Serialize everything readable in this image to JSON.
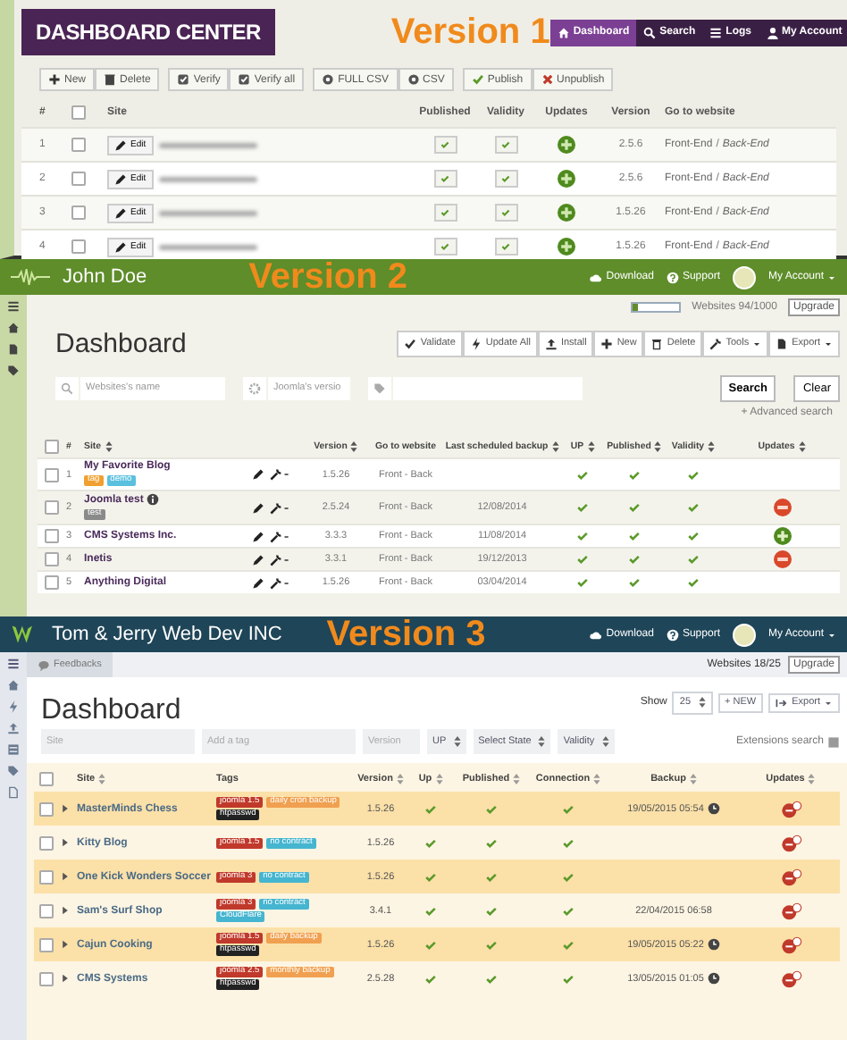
{
  "v1": {
    "brand": "DASHBOARD CENTER",
    "version_label": "Version 1",
    "nav": [
      {
        "label": "Dashboard",
        "selected": true
      },
      {
        "label": "Search",
        "selected": false
      },
      {
        "label": "Logs",
        "selected": false
      },
      {
        "label": "My Account",
        "selected": false
      }
    ],
    "toolbar": [
      [
        {
          "label": "New",
          "kind": "plus"
        },
        {
          "label": "Delete",
          "kind": "trash"
        }
      ],
      [
        {
          "label": "Verify",
          "kind": "check"
        },
        {
          "label": "Verify all",
          "kind": "check"
        }
      ],
      [
        {
          "label": "FULL CSV",
          "kind": "disc"
        },
        {
          "label": "CSV",
          "kind": "disc"
        }
      ],
      [
        {
          "label": "Publish",
          "kind": "tick"
        },
        {
          "label": "Unpublish",
          "kind": "cross"
        }
      ]
    ],
    "select_all_checked": false,
    "columns": [
      "#",
      "Site",
      "Published",
      "Validity",
      "Updates",
      "Version",
      "Go to website"
    ],
    "rows": [
      {
        "num": "1",
        "checked": false,
        "edit": "Edit",
        "published": true,
        "validity": true,
        "updates": {
          "kind": "ok"
        },
        "version": "2.5.6",
        "front": "Front-End",
        "separator": "/",
        "back": "Back-End"
      },
      {
        "num": "2",
        "checked": false,
        "edit": "Edit",
        "published": true,
        "validity": true,
        "updates": {
          "kind": "ok"
        },
        "version": "2.5.6",
        "front": "Front-End",
        "separator": "/",
        "back": "Back-End"
      },
      {
        "num": "3",
        "checked": false,
        "edit": "Edit",
        "published": true,
        "validity": true,
        "updates": {
          "kind": "ok"
        },
        "version": "1.5.26",
        "front": "Front-End",
        "separator": "/",
        "back": "Back-End"
      },
      {
        "num": "4",
        "checked": false,
        "edit": "Edit",
        "published": true,
        "validity": true,
        "updates": {
          "kind": "ok"
        },
        "version": "1.5.26",
        "front": "Front-End",
        "separator": "/",
        "back": "Back-End"
      }
    ]
  },
  "v2": {
    "user": "John Doe",
    "version_label": "Version 2",
    "download": "Download",
    "support": "Support",
    "account": "My Account",
    "quota": {
      "level": 0.094,
      "label": "Websites 94/1000",
      "upgrade": "Upgrade"
    },
    "title": "Dashboard",
    "actions": [
      {
        "label": "Validate",
        "kind": "tick",
        "dropdown": false
      },
      {
        "label": "Update All",
        "kind": "bolt",
        "dropdown": false
      },
      {
        "label": "Install",
        "kind": "upload",
        "dropdown": false
      },
      {
        "label": "New",
        "kind": "plus",
        "dropdown": false
      },
      {
        "label": "Delete",
        "kind": "trash",
        "dropdown": false
      },
      {
        "label": "Tools",
        "kind": "wrench",
        "dropdown": true
      },
      {
        "label": "Export",
        "kind": "file",
        "dropdown": true
      }
    ],
    "filters": [
      {
        "kind": "search",
        "placeholder": "Websites's name"
      },
      {
        "kind": "gear",
        "placeholder": "Joomla's versio"
      },
      {
        "kind": "tag"
      }
    ],
    "search": "Search",
    "clear": "Clear",
    "advanced": "+ Advanced search",
    "select_all_checked": false,
    "columns": [
      {
        "label": "#",
        "sortable": false
      },
      {
        "label": "Site",
        "sortable": true
      },
      {
        "label": "Version",
        "sortable": true
      },
      {
        "label": "Go to website",
        "sortable": false
      },
      {
        "label": "Last scheduled backup",
        "sortable": true
      },
      {
        "label": "UP",
        "sortable": true
      },
      {
        "label": "Published",
        "sortable": true
      },
      {
        "label": "Validity",
        "sortable": true
      },
      {
        "label": "Updates",
        "sortable": true
      }
    ],
    "rows": [
      {
        "num": "1",
        "checked": false,
        "name": "My Favorite Blog",
        "info": false,
        "tags": [
          {
            "label": "tag",
            "color": "#f0a030"
          },
          {
            "label": "demo",
            "color": "#5bc0de"
          }
        ],
        "version": "1.5.26",
        "website": "Front - Back",
        "up": true,
        "published": true,
        "validity": true
      },
      {
        "num": "2",
        "checked": false,
        "name": "Joomla test",
        "info": true,
        "tags": [
          {
            "label": "test",
            "color": "#8a8a8a"
          }
        ],
        "version": "2.5.24",
        "website": "Front - Back",
        "backup": "12/08/2014",
        "up": true,
        "published": true,
        "validity": true,
        "updates": {
          "kind": "warn"
        }
      },
      {
        "num": "3",
        "checked": false,
        "name": "CMS Systems Inc.",
        "info": false,
        "tags": [],
        "version": "3.3.3",
        "website": "Front - Back",
        "backup": "11/08/2014",
        "up": true,
        "published": true,
        "validity": true,
        "updates": {
          "kind": "ok"
        }
      },
      {
        "num": "4",
        "checked": false,
        "name": "Inetis",
        "info": false,
        "tags": [],
        "version": "3.3.1",
        "website": "Front - Back",
        "backup": "19/12/2013",
        "up": true,
        "published": true,
        "validity": true,
        "updates": {
          "kind": "warn"
        }
      },
      {
        "num": "5",
        "checked": false,
        "name": "Anything Digital",
        "info": false,
        "tags": [],
        "version": "1.5.26",
        "website": "Front - Back",
        "backup": "03/04/2014",
        "up": true,
        "published": true,
        "validity": true
      }
    ]
  },
  "v3": {
    "company": "Tom & Jerry Web Dev INC",
    "version_label": "Version 3",
    "download": "Download",
    "support": "Support",
    "account": "My Account",
    "feedbacks": "Feedbacks",
    "quota": "Websites 18/25",
    "upgrade": "Upgrade",
    "title": "Dashboard",
    "show": "Show",
    "show_value": "25",
    "new": "+ NEW",
    "export": "Export",
    "filters": [
      {
        "kind": "input",
        "placeholder": "Site"
      },
      {
        "kind": "input",
        "placeholder": "Add a tag"
      },
      {
        "kind": "input",
        "placeholder": "Version"
      },
      {
        "kind": "select",
        "value": "UP"
      },
      {
        "kind": "select",
        "value": "Select State"
      },
      {
        "kind": "select",
        "value": "Validity"
      }
    ],
    "extensions": "Extensions search",
    "select_all_checked": false,
    "columns": [
      {
        "label": "Site",
        "sortable": true
      },
      {
        "label": "Tags",
        "sortable": false
      },
      {
        "label": "Version",
        "sortable": true
      },
      {
        "label": "Up",
        "sortable": true
      },
      {
        "label": "Published",
        "sortable": true
      },
      {
        "label": "Connection",
        "sortable": true
      },
      {
        "label": "Backup",
        "sortable": true
      },
      {
        "label": "Updates",
        "sortable": true
      }
    ],
    "rows": [
      {
        "checked": false,
        "name": "MasterMinds Chess",
        "tags": [
          {
            "label": "joomla 1.5",
            "color": "#c0392b"
          },
          {
            "label": "daily cron backup",
            "color": "#f0a050"
          },
          {
            "label": "htpasswd",
            "color": "#222222"
          }
        ],
        "version": "1.5.26",
        "up": true,
        "published": true,
        "connection": true,
        "backup": "19/05/2015 05:54",
        "backup_clock": true
      },
      {
        "checked": false,
        "name": "Kitty Blog",
        "tags": [
          {
            "label": "joomla 1.5",
            "color": "#c0392b"
          },
          {
            "label": "no contract",
            "color": "#45b5d0"
          }
        ],
        "version": "1.5.26",
        "up": true,
        "published": true,
        "connection": true,
        "backup_clock": false
      },
      {
        "checked": false,
        "name": "One Kick Wonders Soccer",
        "tags": [
          {
            "label": "joomla 3",
            "color": "#c0392b"
          },
          {
            "label": "no contract",
            "color": "#45b5d0"
          }
        ],
        "version": "1.5.26",
        "up": true,
        "published": true,
        "connection": true,
        "backup_clock": false
      },
      {
        "checked": false,
        "name": "Sam's Surf Shop",
        "tags": [
          {
            "label": "joomla 3",
            "color": "#c0392b"
          },
          {
            "label": "no contract",
            "color": "#45b5d0"
          },
          {
            "label": "CloudFlare",
            "color": "#45b5d0"
          }
        ],
        "version": "3.4.1",
        "up": true,
        "published": true,
        "connection": true,
        "backup": "22/04/2015 06:58",
        "backup_clock": false
      },
      {
        "checked": false,
        "name": "Cajun Cooking",
        "tags": [
          {
            "label": "joomla 1.5",
            "color": "#c0392b"
          },
          {
            "label": "daily backup",
            "color": "#f0a050"
          },
          {
            "label": "htpasswd",
            "color": "#222222"
          }
        ],
        "version": "1.5.26",
        "up": true,
        "published": true,
        "connection": true,
        "backup": "19/05/2015 05:22",
        "backup_clock": true
      },
      {
        "checked": false,
        "name": "CMS Systems",
        "tags": [
          {
            "label": "joomla 2.5",
            "color": "#c0392b"
          },
          {
            "label": "monthly backup",
            "color": "#f0a050"
          },
          {
            "label": "htpasswd",
            "color": "#222222"
          }
        ],
        "version": "2.5.28",
        "up": true,
        "published": true,
        "connection": true,
        "backup": "13/05/2015 01:05",
        "backup_clock": true
      }
    ]
  }
}
